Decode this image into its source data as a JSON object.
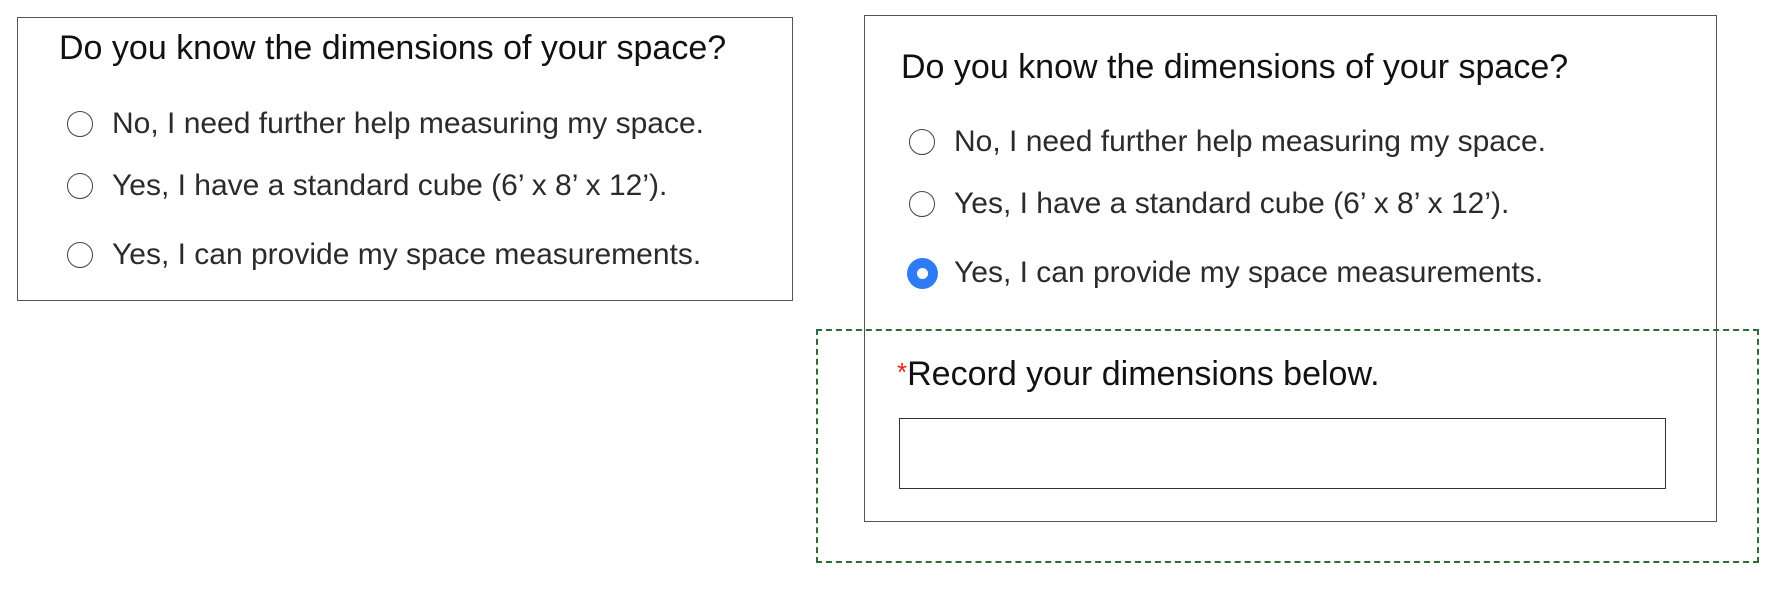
{
  "left_form": {
    "question": "Do you know the dimensions of your space?",
    "options": [
      {
        "label": "No, I need further help measuring my space.",
        "selected": false
      },
      {
        "label": "Yes, I have a standard cube (6’ x 8’ x 12’).",
        "selected": false
      },
      {
        "label": "Yes, I can provide my space measurements.",
        "selected": false
      }
    ]
  },
  "right_form": {
    "question": "Do you know the dimensions of your space?",
    "options": [
      {
        "label": "No, I need further help measuring my space.",
        "selected": false
      },
      {
        "label": "Yes, I have a standard cube (6’ x 8’ x 12’).",
        "selected": false
      },
      {
        "label": "Yes, I can provide my space measurements.",
        "selected": true
      }
    ],
    "dimensions": {
      "required_marker": "*",
      "label": "Record your dimensions below.",
      "value": ""
    }
  },
  "colors": {
    "radio_selected": "#2f7bf5",
    "required_marker": "#e0241b",
    "callout_border": "#2e6b36",
    "panel_border": "#555555"
  }
}
